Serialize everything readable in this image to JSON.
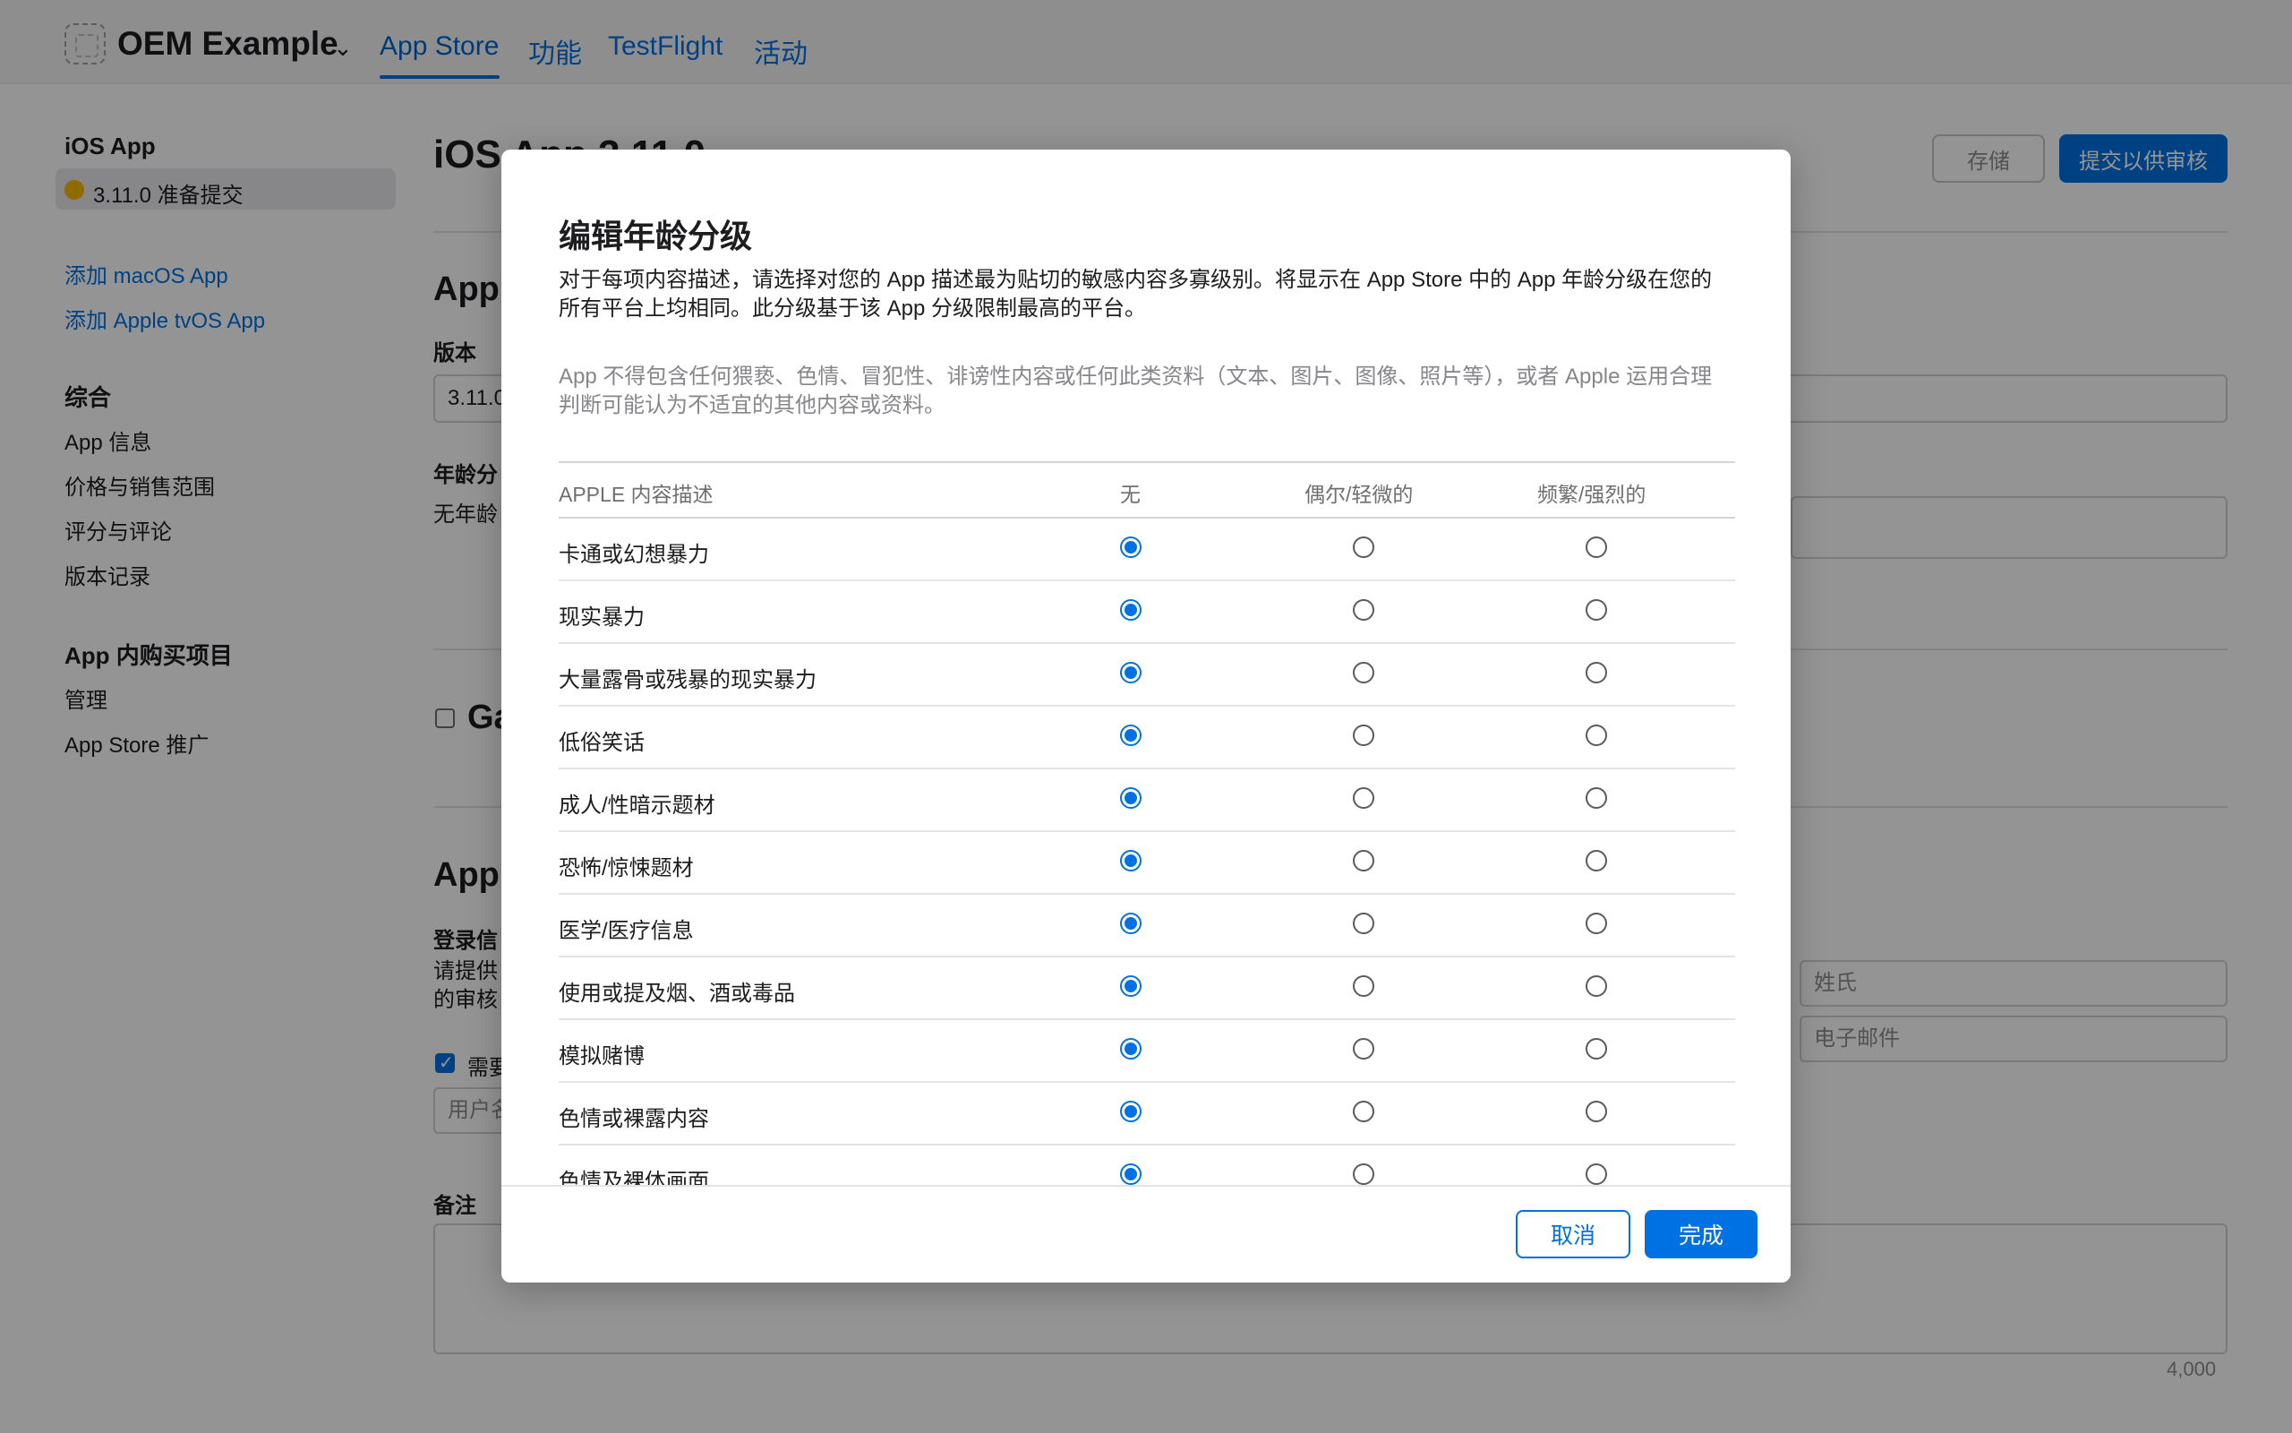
{
  "header": {
    "app_name": "OEM Example",
    "app_menu_icon": "chevron-down-icon",
    "tabs": [
      "App Store",
      "功能",
      "TestFlight",
      "活动"
    ],
    "active_tab": "App Store"
  },
  "sidebar": {
    "platform": "iOS App",
    "version_item": "3.11.0 准备提交",
    "status_color": "#f5b800",
    "add_links": [
      "添加 macOS App",
      "添加 Apple tvOS App"
    ],
    "general_title": "综合",
    "general_items": [
      "App 信息",
      "价格与销售范围",
      "评分与评论",
      "版本记录"
    ],
    "iap_title": "App 内购买项目",
    "iap_items": [
      "管理",
      "App Store 推广"
    ]
  },
  "main": {
    "title": "iOS App 3.11.0",
    "save_label": "存储",
    "submit_label": "提交以供审核",
    "section_app": "App",
    "version_label": "版本",
    "version_value": "3.11.0",
    "age_rating_label": "年龄分",
    "age_rating_value": "无年龄",
    "game_center_label": "Ga",
    "section_review": "App",
    "signin_label": "登录信",
    "signin_desc_1": "请提供",
    "signin_desc_2": "的审核",
    "sign_in_required_label": "需要",
    "username_placeholder": "用户名",
    "last_name_placeholder": "姓氏",
    "email_placeholder": "电子邮件",
    "notes_label": "备注",
    "notes_counter": "4,000"
  },
  "modal": {
    "title": "编辑年龄分级",
    "description": "对于每项内容描述，请选择对您的 App 描述最为贴切的敏感内容多寡级别。将显示在 App Store 中的 App 年龄分级在您的所有平台上均相同。此分级基于该 App 分级限制最高的平台。",
    "note": "App 不得包含任何猥亵、色情、冒犯性、诽谤性内容或任何此类资料（文本、图片、图像、照片等），或者 Apple 运用合理判断可能认为不适宜的其他内容或资料。",
    "columns": [
      "APPLE 内容描述",
      "无",
      "偶尔/轻微的",
      "频繁/强烈的"
    ],
    "rows": [
      {
        "label": "卡通或幻想暴力",
        "selected": "无"
      },
      {
        "label": "现实暴力",
        "selected": "无"
      },
      {
        "label": "大量露骨或残暴的现实暴力",
        "selected": "无"
      },
      {
        "label": "低俗笑话",
        "selected": "无"
      },
      {
        "label": "成人/性暗示题材",
        "selected": "无"
      },
      {
        "label": "恐怖/惊悚题材",
        "selected": "无"
      },
      {
        "label": "医学/医疗信息",
        "selected": "无"
      },
      {
        "label": "使用或提及烟、酒或毒品",
        "selected": "无"
      },
      {
        "label": "模拟赌博",
        "selected": "无"
      },
      {
        "label": "色情或裸露内容",
        "selected": "无"
      },
      {
        "label": "色情及裸体画面",
        "selected": "无"
      }
    ],
    "cancel_label": "取消",
    "done_label": "完成"
  },
  "colors": {
    "accent": "#0071e3",
    "overlay": "rgba(0,0,0,0.42)"
  }
}
